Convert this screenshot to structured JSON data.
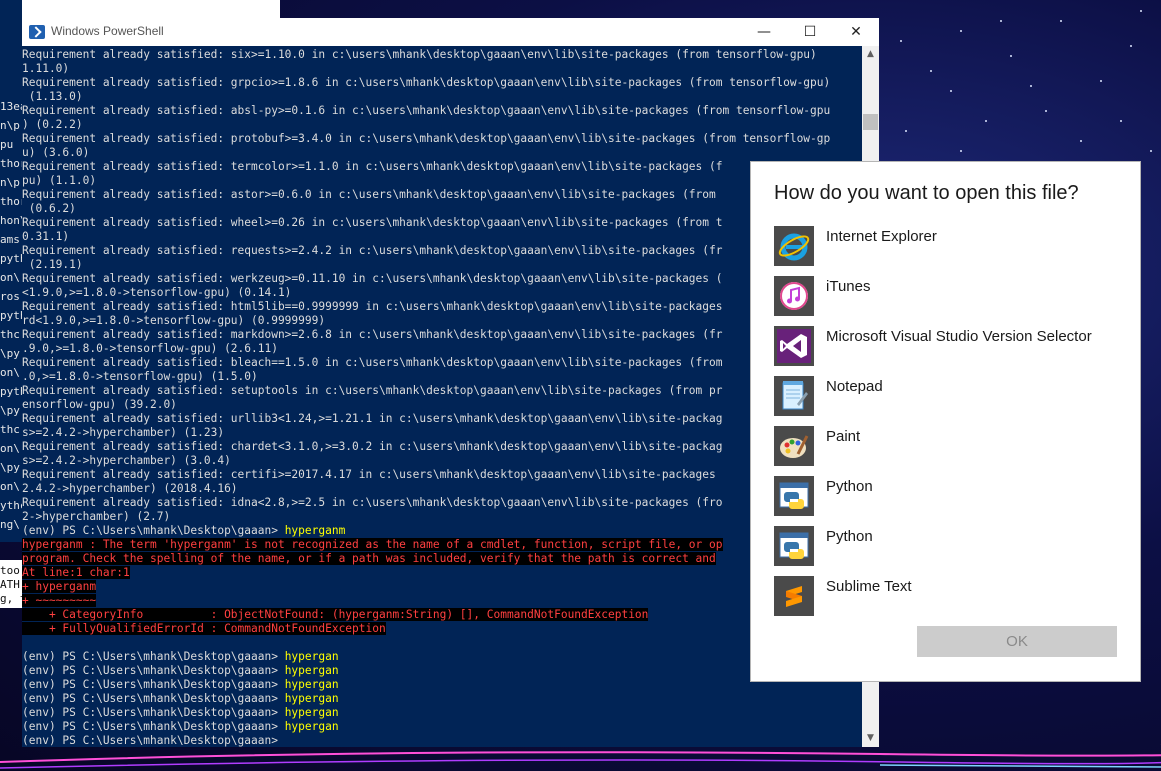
{
  "powershell": {
    "title": "Windows PowerShell",
    "controls": {
      "minimize": "—",
      "maximize": "☐",
      "close": "✕"
    },
    "lines": [
      {
        "t": "Requirement already satisfied: six>=1.10.0 in c:\\users\\mhank\\desktop\\gaaan\\env\\lib\\site-packages (from tensorflow-gpu)",
        "k": "n"
      },
      {
        "t": "1.11.0)",
        "k": "n"
      },
      {
        "t": "Requirement already satisfied: grpcio>=1.8.6 in c:\\users\\mhank\\desktop\\gaaan\\env\\lib\\site-packages (from tensorflow-gpu)",
        "k": "n"
      },
      {
        "t": " (1.13.0)",
        "k": "n"
      },
      {
        "t": "Requirement already satisfied: absl-py>=0.1.6 in c:\\users\\mhank\\desktop\\gaaan\\env\\lib\\site-packages (from tensorflow-gpu",
        "k": "n"
      },
      {
        "t": ") (0.2.2)",
        "k": "n"
      },
      {
        "t": "Requirement already satisfied: protobuf>=3.4.0 in c:\\users\\mhank\\desktop\\gaaan\\env\\lib\\site-packages (from tensorflow-gp",
        "k": "n"
      },
      {
        "t": "u) (3.6.0)",
        "k": "n"
      },
      {
        "t": "Requirement already satisfied: termcolor>=1.1.0 in c:\\users\\mhank\\desktop\\gaaan\\env\\lib\\site-packages (f",
        "k": "n"
      },
      {
        "t": "pu) (1.1.0)",
        "k": "n"
      },
      {
        "t": "Requirement already satisfied: astor>=0.6.0 in c:\\users\\mhank\\desktop\\gaaan\\env\\lib\\site-packages (from",
        "k": "n"
      },
      {
        "t": " (0.6.2)",
        "k": "n"
      },
      {
        "t": "Requirement already satisfied: wheel>=0.26 in c:\\users\\mhank\\desktop\\gaaan\\env\\lib\\site-packages (from t",
        "k": "n"
      },
      {
        "t": "0.31.1)",
        "k": "n"
      },
      {
        "t": "Requirement already satisfied: requests>=2.4.2 in c:\\users\\mhank\\desktop\\gaaan\\env\\lib\\site-packages (fr",
        "k": "n"
      },
      {
        "t": " (2.19.1)",
        "k": "n"
      },
      {
        "t": "Requirement already satisfied: werkzeug>=0.11.10 in c:\\users\\mhank\\desktop\\gaaan\\env\\lib\\site-packages (",
        "k": "n"
      },
      {
        "t": "<1.9.0,>=1.8.0->tensorflow-gpu) (0.14.1)",
        "k": "n"
      },
      {
        "t": "Requirement already satisfied: html5lib==0.9999999 in c:\\users\\mhank\\desktop\\gaaan\\env\\lib\\site-packages",
        "k": "n"
      },
      {
        "t": "rd<1.9.0,>=1.8.0->tensorflow-gpu) (0.9999999)",
        "k": "n"
      },
      {
        "t": "Requirement already satisfied: markdown>=2.6.8 in c:\\users\\mhank\\desktop\\gaaan\\env\\lib\\site-packages (fr",
        "k": "n"
      },
      {
        "t": ".9.0,>=1.8.0->tensorflow-gpu) (2.6.11)",
        "k": "n"
      },
      {
        "t": "Requirement already satisfied: bleach==1.5.0 in c:\\users\\mhank\\desktop\\gaaan\\env\\lib\\site-packages (from",
        "k": "n"
      },
      {
        "t": ".0,>=1.8.0->tensorflow-gpu) (1.5.0)",
        "k": "n"
      },
      {
        "t": "Requirement already satisfied: setuptools in c:\\users\\mhank\\desktop\\gaaan\\env\\lib\\site-packages (from pr",
        "k": "n"
      },
      {
        "t": "ensorflow-gpu) (39.2.0)",
        "k": "n"
      },
      {
        "t": "Requirement already satisfied: urllib3<1.24,>=1.21.1 in c:\\users\\mhank\\desktop\\gaaan\\env\\lib\\site-packag",
        "k": "n"
      },
      {
        "t": "s>=2.4.2->hyperchamber) (1.23)",
        "k": "n"
      },
      {
        "t": "Requirement already satisfied: chardet<3.1.0,>=3.0.2 in c:\\users\\mhank\\desktop\\gaaan\\env\\lib\\site-packag",
        "k": "n"
      },
      {
        "t": "s>=2.4.2->hyperchamber) (3.0.4)",
        "k": "n"
      },
      {
        "t": "Requirement already satisfied: certifi>=2017.4.17 in c:\\users\\mhank\\desktop\\gaaan\\env\\lib\\site-packages",
        "k": "n"
      },
      {
        "t": "2.4.2->hyperchamber) (2018.4.16)",
        "k": "n"
      },
      {
        "t": "Requirement already satisfied: idna<2.8,>=2.5 in c:\\users\\mhank\\desktop\\gaaan\\env\\lib\\site-packages (fro",
        "k": "n"
      },
      {
        "t": "2->hyperchamber) (2.7)",
        "k": "n"
      },
      {
        "t": "(env) PS C:\\Users\\mhank\\Desktop\\gaaan> ",
        "k": "p",
        "c": "hyperganm"
      },
      {
        "t": "hyperganm : The term 'hyperganm' is not recognized as the name of a cmdlet, function, script file, or op",
        "k": "e"
      },
      {
        "t": "program. Check the spelling of the name, or if a path was included, verify that the path is correct and",
        "k": "e"
      },
      {
        "t": "At line:1 char:1",
        "k": "e"
      },
      {
        "t": "+ hyperganm",
        "k": "e"
      },
      {
        "t": "+ ~~~~~~~~~",
        "k": "e"
      },
      {
        "t": "    + CategoryInfo          : ObjectNotFound: (hyperganm:String) [], CommandNotFoundException",
        "k": "e"
      },
      {
        "t": "    + FullyQualifiedErrorId : CommandNotFoundException",
        "k": "e"
      },
      {
        "t": "",
        "k": "n"
      },
      {
        "t": "(env) PS C:\\Users\\mhank\\Desktop\\gaaan> ",
        "k": "p",
        "c": "hypergan"
      },
      {
        "t": "(env) PS C:\\Users\\mhank\\Desktop\\gaaan> ",
        "k": "p",
        "c": "hypergan"
      },
      {
        "t": "(env) PS C:\\Users\\mhank\\Desktop\\gaaan> ",
        "k": "p",
        "c": "hypergan"
      },
      {
        "t": "(env) PS C:\\Users\\mhank\\Desktop\\gaaan> ",
        "k": "p",
        "c": "hypergan"
      },
      {
        "t": "(env) PS C:\\Users\\mhank\\Desktop\\gaaan> ",
        "k": "p",
        "c": "hypergan"
      },
      {
        "t": "(env) PS C:\\Users\\mhank\\Desktop\\gaaan> ",
        "k": "p",
        "c": "hypergan"
      },
      {
        "t": "(env) PS C:\\Users\\mhank\\Desktop\\gaaan>",
        "k": "p",
        "c": ""
      }
    ],
    "colors": {
      "background": "#012456",
      "text": "#dcdcdc",
      "error": "#ff4040",
      "command": "#ffff00"
    }
  },
  "background_window": {
    "fragments": [
      "13ea",
      "n\\p",
      "pu",
      "thor",
      "n\\p",
      "thor",
      "hon\\",
      "ams",
      "pyth",
      "on\\",
      "ros",
      "pyth",
      "thc",
      "\\py",
      "on\\",
      "pyth",
      "\\py",
      "thc",
      "on\\",
      "\\py",
      "on\\",
      "ythc",
      "ng\\"
    ],
    "fragments2": [
      "too",
      "ATH.",
      "g, t"
    ]
  },
  "open_with_dialog": {
    "title": "How do you want to open this file?",
    "apps": [
      {
        "label": "Internet Explorer",
        "icon": "internet-explorer-icon"
      },
      {
        "label": "iTunes",
        "icon": "itunes-icon"
      },
      {
        "label": "Microsoft Visual Studio Version Selector",
        "icon": "visual-studio-icon"
      },
      {
        "label": "Notepad",
        "icon": "notepad-icon"
      },
      {
        "label": "Paint",
        "icon": "paint-icon"
      },
      {
        "label": "Python",
        "icon": "python-icon"
      },
      {
        "label": "Python",
        "icon": "python-icon"
      },
      {
        "label": "Sublime Text",
        "icon": "sublime-text-icon"
      }
    ],
    "ok_label": "OK"
  }
}
